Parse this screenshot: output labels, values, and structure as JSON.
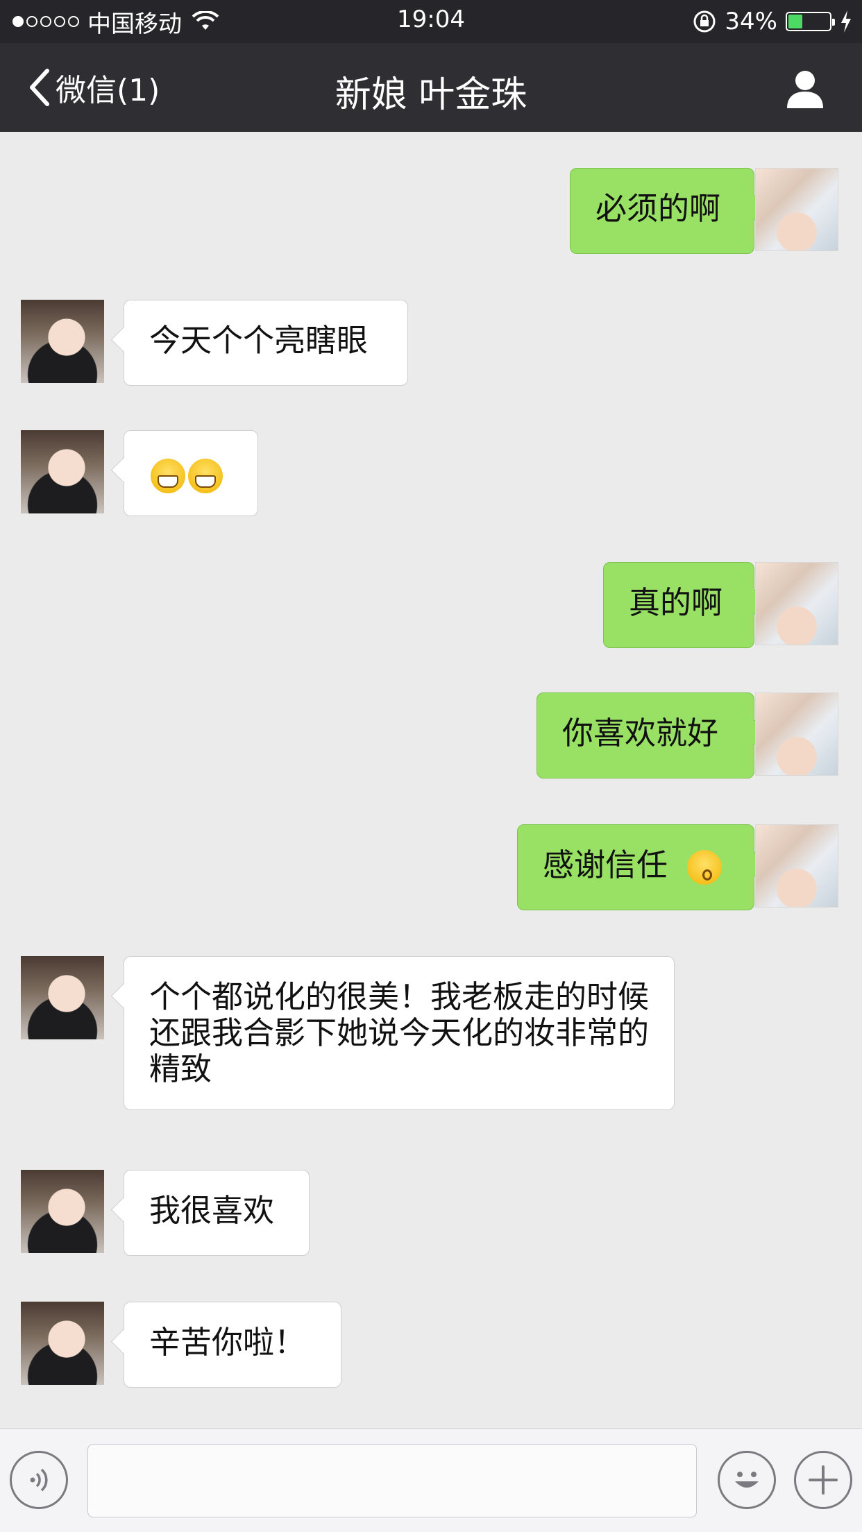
{
  "status_bar": {
    "carrier": "中国移动",
    "time": "19:04",
    "battery_percent": "34%",
    "battery_level": 0.34,
    "signal_dots_filled": 1,
    "signal_dots_total": 5
  },
  "nav": {
    "back_label": "微信(1)",
    "title": "新娘 叶金珠"
  },
  "messages": [
    {
      "side": "right",
      "text": "必须的啊"
    },
    {
      "side": "left",
      "text": "今天个个亮瞎眼"
    },
    {
      "side": "left",
      "text": "",
      "emoji": [
        "grin",
        "grin"
      ]
    },
    {
      "side": "right",
      "text": "真的啊"
    },
    {
      "side": "right",
      "text": "你喜欢就好"
    },
    {
      "side": "right",
      "text": "感谢信任",
      "emoji_after": "kiss"
    },
    {
      "side": "left",
      "text": "个个都说化的很美！我老板走的时候还跟我合影下她说今天化的妆非常的精致"
    },
    {
      "side": "left",
      "text": "我很喜欢"
    },
    {
      "side": "left",
      "text": "辛苦你啦！"
    }
  ],
  "input": {
    "value": ""
  },
  "colors": {
    "sent_bubble": "#98e165",
    "received_bubble": "#ffffff",
    "nav_background": "#2f2f33",
    "chat_background": "#ebebeb"
  }
}
